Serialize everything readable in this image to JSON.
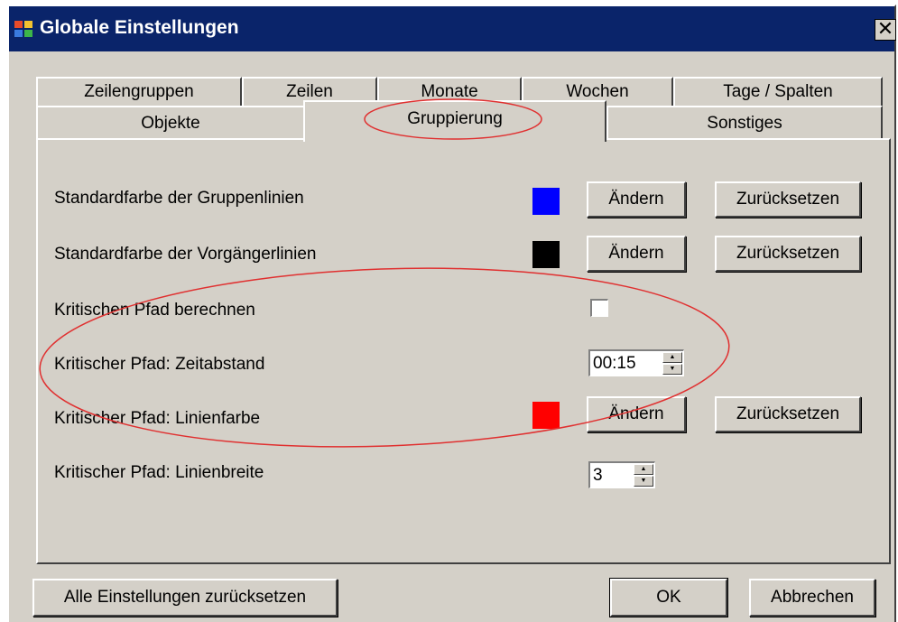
{
  "window": {
    "title": "Globale Einstellungen",
    "close_glyph": "✕"
  },
  "tabs": {
    "row1": [
      "Zeilengruppen",
      "Zeilen",
      "Monate",
      "Wochen",
      "Tage / Spalten"
    ],
    "row2": [
      "Objekte",
      "Gruppierung",
      "Sonstiges"
    ],
    "active": "Gruppierung"
  },
  "settings": {
    "group_line_color": {
      "label": "Standardfarbe der Gruppenlinien",
      "color": "#0000ff",
      "change_label": "Ändern",
      "reset_label": "Zurücksetzen"
    },
    "predecessor_line_color": {
      "label": "Standardfarbe der Vorgängerlinien",
      "color": "#000000",
      "change_label": "Ändern",
      "reset_label": "Zurücksetzen"
    },
    "critical_path_calc": {
      "label": "Kritischen Pfad berechnen",
      "checked": false
    },
    "critical_path_interval": {
      "label": "Kritischer Pfad: Zeitabstand",
      "value": "00:15"
    },
    "critical_path_color": {
      "label": "Kritischer Pfad: Linienfarbe",
      "color": "#ff0000",
      "change_label": "Ändern",
      "reset_label": "Zurücksetzen"
    },
    "critical_path_width": {
      "label": "Kritischer Pfad: Linienbreite",
      "value": "3"
    }
  },
  "footer": {
    "reset_all_label": "Alle Einstellungen zurücksetzen",
    "ok_label": "OK",
    "cancel_label": "Abbrechen"
  },
  "icons": [
    "app-icon",
    "close-icon",
    "spin-up-icon",
    "spin-down-icon"
  ],
  "colors": {
    "titlebar": "#0a246a",
    "dialog": "#d4d0c8",
    "annotation": "#e03030"
  }
}
